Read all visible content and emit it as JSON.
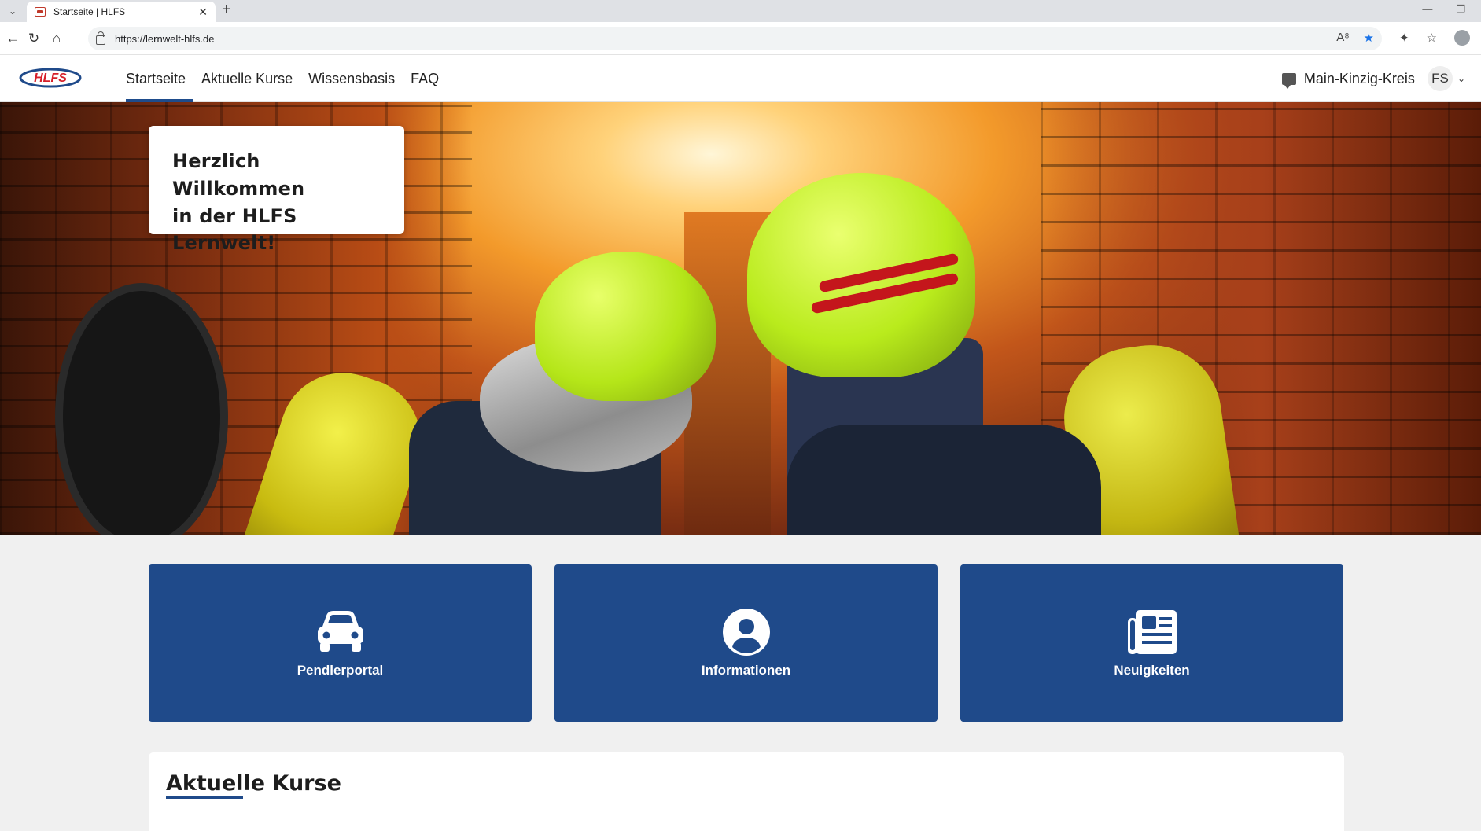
{
  "browser": {
    "tab_title": "Startseite | HLFS",
    "url": "https://lernwelt-hlfs.de"
  },
  "header": {
    "logo_text": "HLFS",
    "nav": [
      {
        "label": "Startseite",
        "active": true
      },
      {
        "label": "Aktuelle Kurse",
        "active": false
      },
      {
        "label": "Wissensbasis",
        "active": false
      },
      {
        "label": "FAQ",
        "active": false
      }
    ],
    "district": "Main-Kinzig-Kreis",
    "user_initials": "FS"
  },
  "hero": {
    "welcome_line1": "Herzlich Willkommen",
    "welcome_line2": "in der HLFS Lernwelt!"
  },
  "tiles": [
    {
      "label": "Pendlerportal",
      "icon": "car-icon"
    },
    {
      "label": "Informationen",
      "icon": "user-circle-icon"
    },
    {
      "label": "Neuigkeiten",
      "icon": "newspaper-icon"
    }
  ],
  "courses": {
    "title": "Aktuelle Kurse"
  },
  "colors": {
    "brand_blue": "#1f4a8a",
    "brand_red": "#d6202a"
  }
}
